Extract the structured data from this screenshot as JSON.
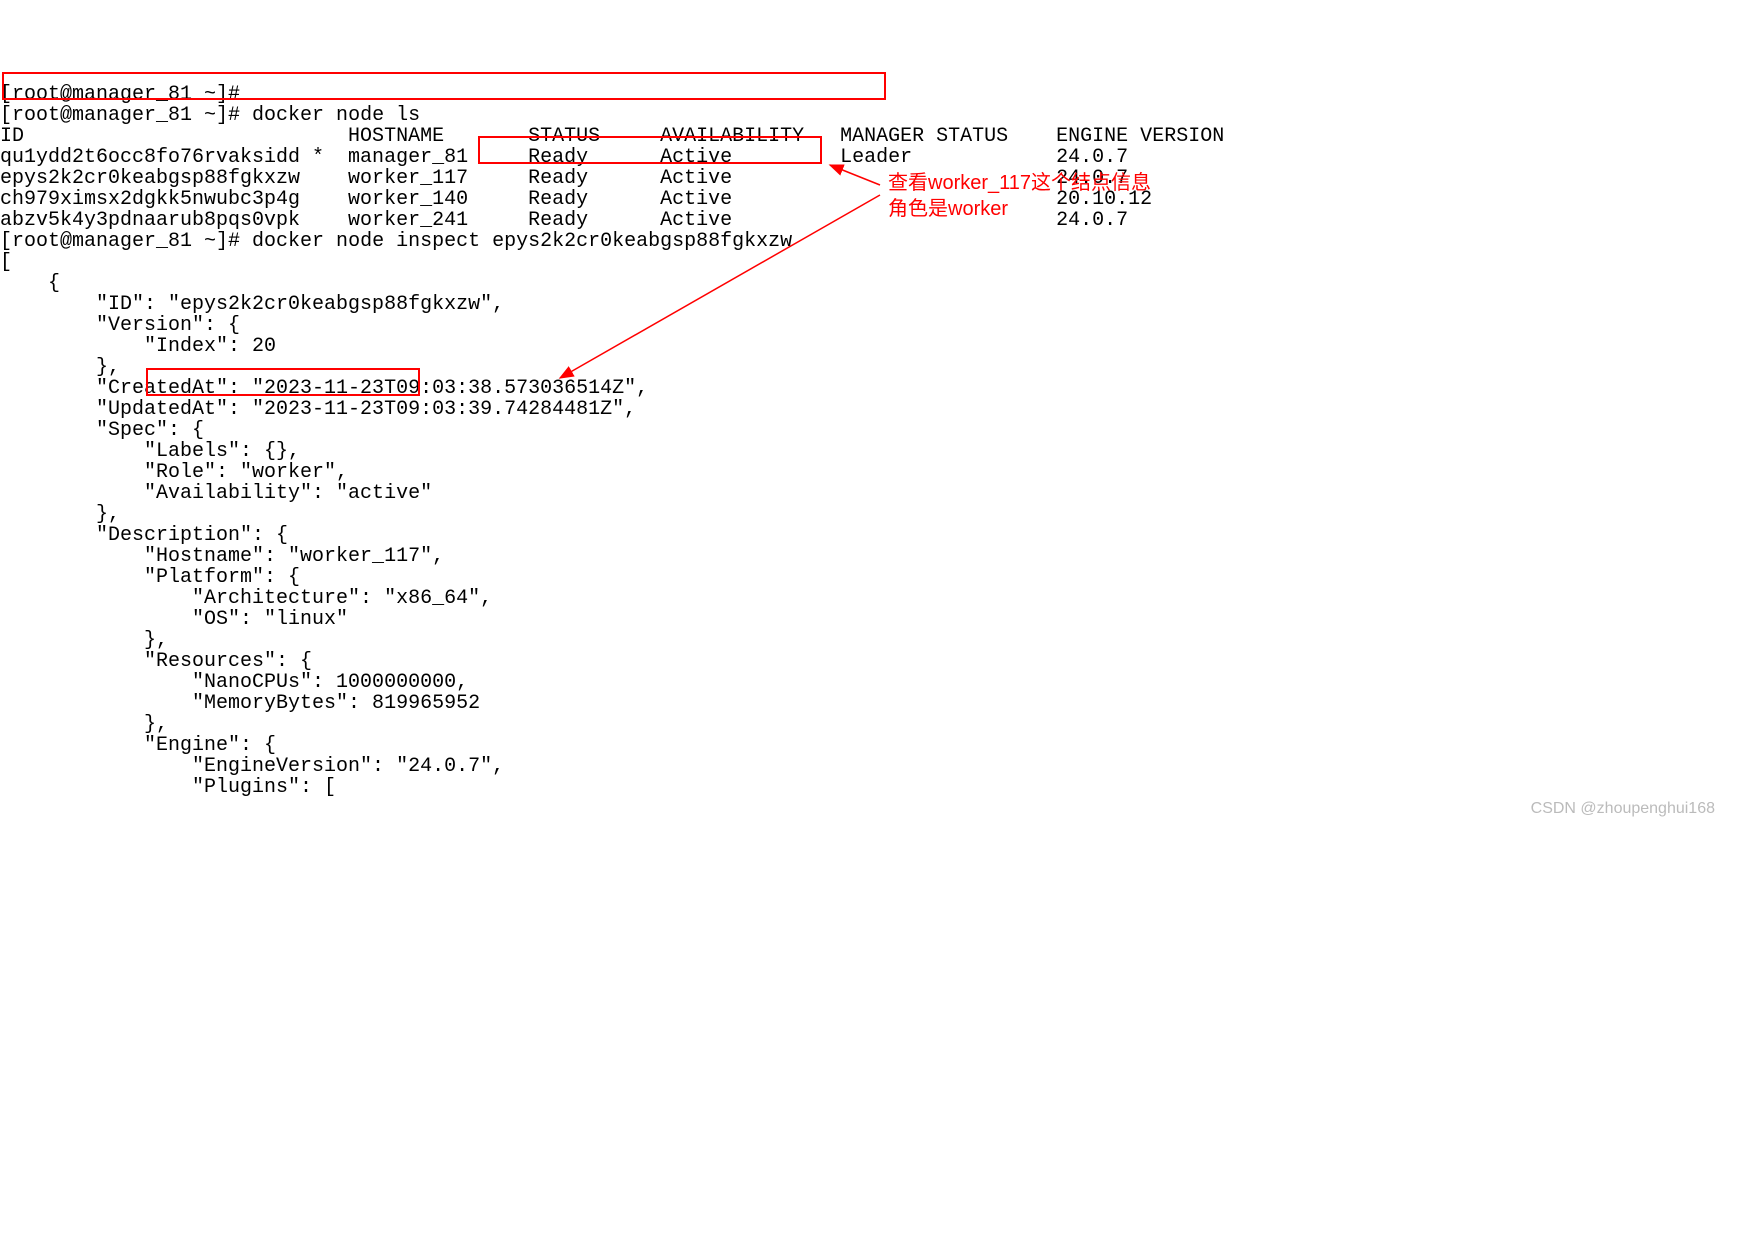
{
  "prompt_prefix_cut": "[root@manager_81 ~]#",
  "prompt1": "[root@manager_81 ~]# ",
  "cmd1": "docker node ls",
  "header": {
    "id": "ID",
    "hostname": "HOSTNAME",
    "status": "STATUS",
    "availability": "AVAILABILITY",
    "manager_status": "MANAGER STATUS",
    "engine_version": "ENGINE VERSION"
  },
  "rows": [
    {
      "id": "qu1ydd2t6occ8fo76rvaksidd *",
      "hostname": "manager_81",
      "status": "Ready",
      "availability": "Active",
      "manager_status": "Leader",
      "engine_version": "24.0.7"
    },
    {
      "id": "epys2k2cr0keabgsp88fgkxzw",
      "hostname": "worker_117",
      "status": "Ready",
      "availability": "Active",
      "manager_status": "",
      "engine_version": "24.0.7"
    },
    {
      "id": "ch979ximsx2dgkk5nwubc3p4g",
      "hostname": "worker_140",
      "status": "Ready",
      "availability": "Active",
      "manager_status": "",
      "engine_version": "20.10.12"
    },
    {
      "id": "abzv5k4y3pdnaarub8pqs0vpk",
      "hostname": "worker_241",
      "status": "Ready",
      "availability": "Active",
      "manager_status": "",
      "engine_version": "24.0.7"
    }
  ],
  "prompt2": "[root@manager_81 ~]# ",
  "cmd2_pre": "docker node inspect ",
  "cmd2_arg": "epys2k2cr0keabgsp88fgkxzw",
  "json_out": "[\n    {\n        \"ID\": \"epys2k2cr0keabgsp88fgkxzw\",\n        \"Version\": {\n            \"Index\": 20\n        },\n        \"CreatedAt\": \"2023-11-23T09:03:38.573036514Z\",\n        \"UpdatedAt\": \"2023-11-23T09:03:39.74284481Z\",\n        \"Spec\": {\n            \"Labels\": {},\n            \"Role\": \"worker\",\n            \"Availability\": \"active\"\n        },\n        \"Description\": {\n            \"Hostname\": \"worker_117\",\n            \"Platform\": {\n                \"Architecture\": \"x86_64\",\n                \"OS\": \"linux\"\n            },\n            \"Resources\": {\n                \"NanoCPUs\": 1000000000,\n                \"MemoryBytes\": 819965952\n            },\n            \"Engine\": {\n                \"EngineVersion\": \"24.0.7\",\n                \"Plugins\": [",
  "annotation": {
    "line1": "查看worker_117这个结点信息",
    "line2": "角色是worker"
  },
  "watermark": "CSDN @zhoupenghui168"
}
